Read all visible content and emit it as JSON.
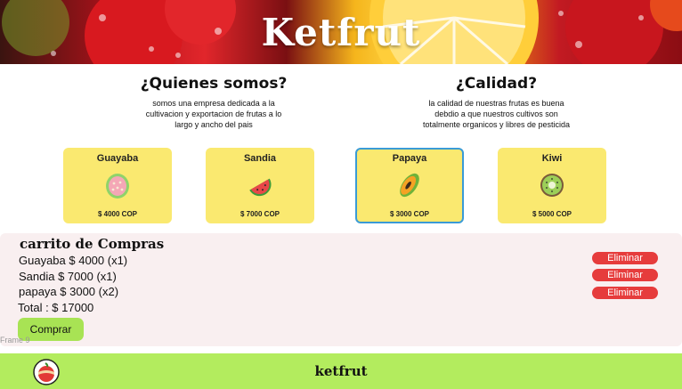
{
  "colors": {
    "card_bg": "#fae970",
    "selected_border": "#3a9bd6",
    "cart_bg": "#f9eff0",
    "remove_button": "#e63c3c",
    "buy_button": "#a8e354",
    "footer_bg": "#b3ec5e"
  },
  "hero": {
    "title": "Ketfrut",
    "background_icon": "citrus-berries-photo"
  },
  "about": {
    "title": "¿Quienes somos?",
    "text": "somos una empresa dedicada a la cultivacion y exportacion de frutas a lo largo y ancho del pais"
  },
  "quality": {
    "title": "¿Calidad?",
    "text": "la calidad de nuestras frutas es buena debdio a que nuestros cultivos son totalmente organicos y libres de pesticida"
  },
  "products": [
    {
      "name": "Guayaba",
      "price": "$ 4000 COP",
      "icon": "guava-icon"
    },
    {
      "name": "Sandia",
      "price": "$ 7000 COP",
      "icon": "watermelon-icon"
    },
    {
      "name": "Papaya",
      "price": "$ 3000 COP",
      "icon": "papaya-icon",
      "selected": true
    },
    {
      "name": "Kiwi",
      "price": "$ 5000 COP",
      "icon": "kiwi-icon"
    }
  ],
  "cart": {
    "title": "carrito de Compras",
    "items": [
      {
        "text": "Guayaba $ 4000 (x1)",
        "remove_label": "Eliminar"
      },
      {
        "text": "Sandia $ 7000 (x1)",
        "remove_label": "Eliminar"
      },
      {
        "text": "papaya $ 3000 (x2)",
        "remove_label": "Eliminar"
      }
    ],
    "total": "Total : $ 17000",
    "buy_label": "Comprar",
    "frame_label": "Frame 9"
  },
  "footer": {
    "title": "ketfrut",
    "logo_icon": "fruit-logo-icon"
  }
}
